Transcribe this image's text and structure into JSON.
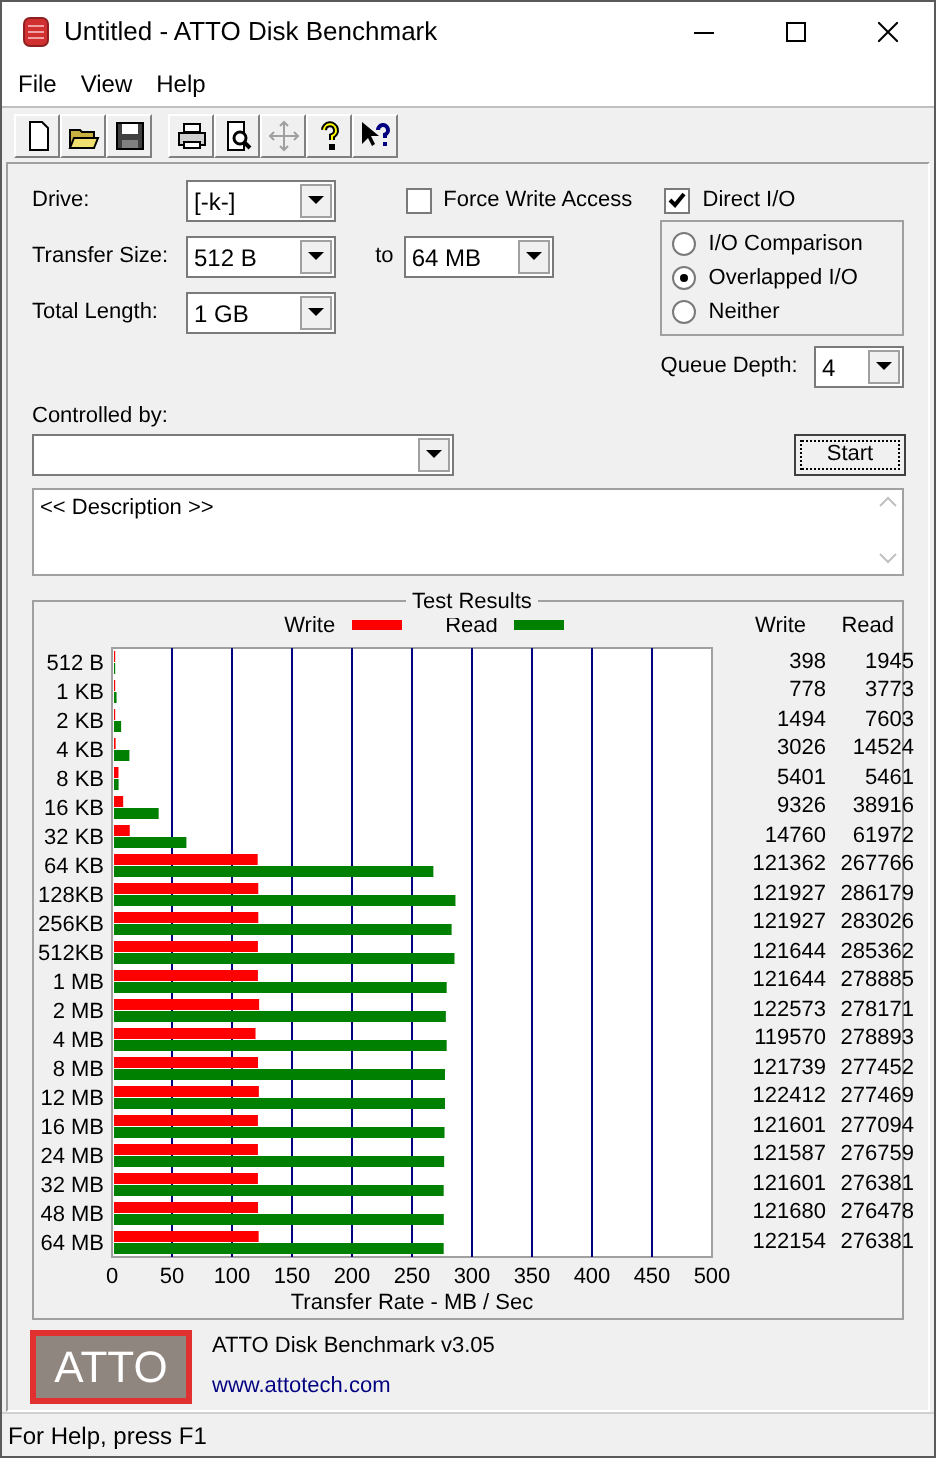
{
  "window": {
    "title": "Untitled - ATTO Disk Benchmark"
  },
  "menu": [
    "File",
    "View",
    "Help"
  ],
  "toolbar": [
    {
      "kind": "new",
      "disabled": false
    },
    {
      "kind": "open",
      "disabled": false
    },
    {
      "kind": "save",
      "disabled": false
    },
    {
      "kind": "print",
      "disabled": false
    },
    {
      "kind": "preview",
      "disabled": false
    },
    {
      "kind": "move",
      "disabled": true
    },
    {
      "kind": "help",
      "disabled": false
    },
    {
      "kind": "context_help",
      "disabled": false
    }
  ],
  "drive": {
    "label": "Drive:",
    "value": "[-k-]"
  },
  "transfer_size": {
    "label": "Transfer Size:",
    "from": "512 B",
    "to_label": "to",
    "to": "64 MB"
  },
  "total_length": {
    "label": "Total Length:",
    "value": "1 GB"
  },
  "force_write_access": {
    "label": "Force Write Access",
    "checked": false
  },
  "direct_io": {
    "label": "Direct I/O",
    "checked": true
  },
  "io_modes": [
    {
      "label": "I/O Comparison",
      "selected": false
    },
    {
      "label": "Overlapped I/O",
      "selected": true
    },
    {
      "label": "Neither",
      "selected": false
    }
  ],
  "queue_depth": {
    "label": "Queue Depth:",
    "value": "4"
  },
  "controlled_by": {
    "label": "Controlled by:"
  },
  "start_button": "Start",
  "description": {
    "value": "<< Description >>"
  },
  "test_results": {
    "title": "Test Results",
    "headers": [
      "Write",
      "Read"
    ],
    "rows": [
      {
        "write": "398",
        "read": "1945"
      },
      {
        "write": "778",
        "read": "3773"
      },
      {
        "write": "1494",
        "read": "7603"
      },
      {
        "write": "3026",
        "read": "14524"
      },
      {
        "write": "5401",
        "read": "5461"
      },
      {
        "write": "9326",
        "read": "38916"
      },
      {
        "write": "14760",
        "read": "61972"
      },
      {
        "write": "121362",
        "read": "267766"
      },
      {
        "write": "121927",
        "read": "286179"
      },
      {
        "write": "121927",
        "read": "283026"
      },
      {
        "write": "121644",
        "read": "285362"
      },
      {
        "write": "121644",
        "read": "278885"
      },
      {
        "write": "122573",
        "read": "278171"
      },
      {
        "write": "119570",
        "read": "278893"
      },
      {
        "write": "121739",
        "read": "277452"
      },
      {
        "write": "122412",
        "read": "277469"
      },
      {
        "write": "121601",
        "read": "277094"
      },
      {
        "write": "121587",
        "read": "276759"
      },
      {
        "write": "121601",
        "read": "276381"
      },
      {
        "write": "121680",
        "read": "276478"
      },
      {
        "write": "122154",
        "read": "276381"
      }
    ],
    "chart_data": {
      "type": "bar",
      "orientation": "horizontal",
      "xlabel": "Transfer Rate - MB / Sec",
      "categories": [
        "512 B",
        "1 KB",
        "2 KB",
        "4 KB",
        "8 KB",
        "16 KB",
        "32 KB",
        "64 KB",
        "128KB",
        "256KB",
        "512KB",
        "1 MB",
        "2 MB",
        "4 MB",
        "8 MB",
        "12 MB",
        "16 MB",
        "24 MB",
        "32 MB",
        "48 MB",
        "64 MB"
      ],
      "series": [
        {
          "name": "Write",
          "color": "#ff0000",
          "values": [
            0.4,
            0.8,
            1.5,
            3,
            5.4,
            9.3,
            14.8,
            121.4,
            121.9,
            121.9,
            121.6,
            121.6,
            122.6,
            119.6,
            121.7,
            122.4,
            121.6,
            121.6,
            121.6,
            121.7,
            122.2
          ]
        },
        {
          "name": "Read",
          "color": "#008000",
          "values": [
            1.9,
            3.8,
            7.6,
            14.5,
            5.5,
            38.9,
            62,
            267.8,
            286.2,
            283,
            285.4,
            278.9,
            278.2,
            278.9,
            277.5,
            277.5,
            277.1,
            276.8,
            276.4,
            276.5,
            276.4
          ]
        }
      ],
      "grid": true,
      "xlim": [
        0,
        500
      ],
      "xticks": [
        0,
        50,
        100,
        150,
        200,
        250,
        300,
        350,
        400,
        450,
        500
      ]
    }
  },
  "footer": {
    "logo": "ATTO",
    "product": "ATTO Disk Benchmark v3.05",
    "link": "www.attotech.com"
  },
  "status_bar": "For Help, press F1"
}
